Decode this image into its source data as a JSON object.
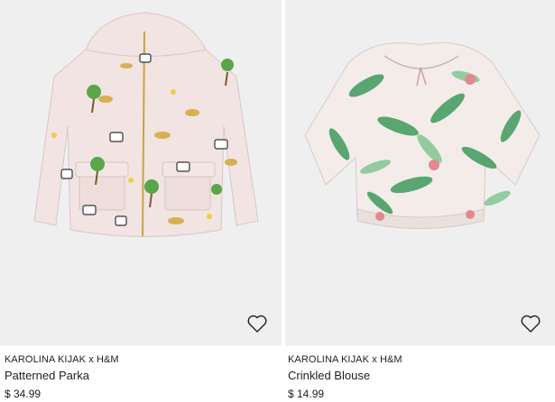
{
  "products": [
    {
      "brand": "KAROLINA KIJAK x H&M",
      "name": "Patterned Parka",
      "price": "$ 34.99",
      "favorite_icon": "heart-outline-icon"
    },
    {
      "brand": "KAROLINA KIJAK x H&M",
      "name": "Crinkled Blouse",
      "price": "$ 14.99",
      "favorite_icon": "heart-outline-icon"
    }
  ],
  "colors": {
    "image_background": "#efefef",
    "text": "#222222",
    "parka_fabric": "#f1e4e2",
    "blouse_leaf": "#3f9a5b"
  }
}
